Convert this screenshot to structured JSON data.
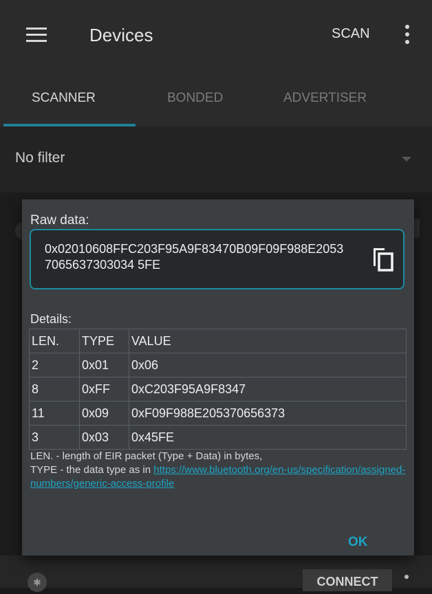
{
  "appbar": {
    "title": "Devices",
    "scan_label": "SCAN"
  },
  "tabs": [
    {
      "label": "SCANNER",
      "active": true
    },
    {
      "label": "BONDED",
      "active": false
    },
    {
      "label": "ADVERTISER",
      "active": false
    }
  ],
  "filter": {
    "label": "No filter"
  },
  "background_row": {
    "connect_label": "CONNECT"
  },
  "dialog": {
    "raw_label": "Raw data:",
    "raw_value": "0x02010608FFC203F95A9F83470B09F09F988E20537065637303034 5FE",
    "details_label": "Details:",
    "table": {
      "headers": [
        "LEN.",
        "TYPE",
        "VALUE"
      ],
      "rows": [
        [
          "2",
          "0x01",
          "0x06"
        ],
        [
          "8",
          "0xFF",
          "0xC203F95A9F8347"
        ],
        [
          "11",
          "0x09",
          "0xF09F988E205370656373"
        ],
        [
          "3",
          "0x03",
          "0x45FE"
        ]
      ]
    },
    "legend_line1": "LEN. - length of EIR packet (Type + Data) in bytes,",
    "legend_line2_prefix": "TYPE - the data type as in ",
    "legend_link": "https://www.bluetooth.org/en-us/specification/assigned-numbers/generic-access-profile",
    "ok_label": "OK"
  },
  "colors": {
    "accent": "#1fa3c3",
    "indicator": "#1f7f96",
    "dialog_bg": "#3b3f42"
  }
}
